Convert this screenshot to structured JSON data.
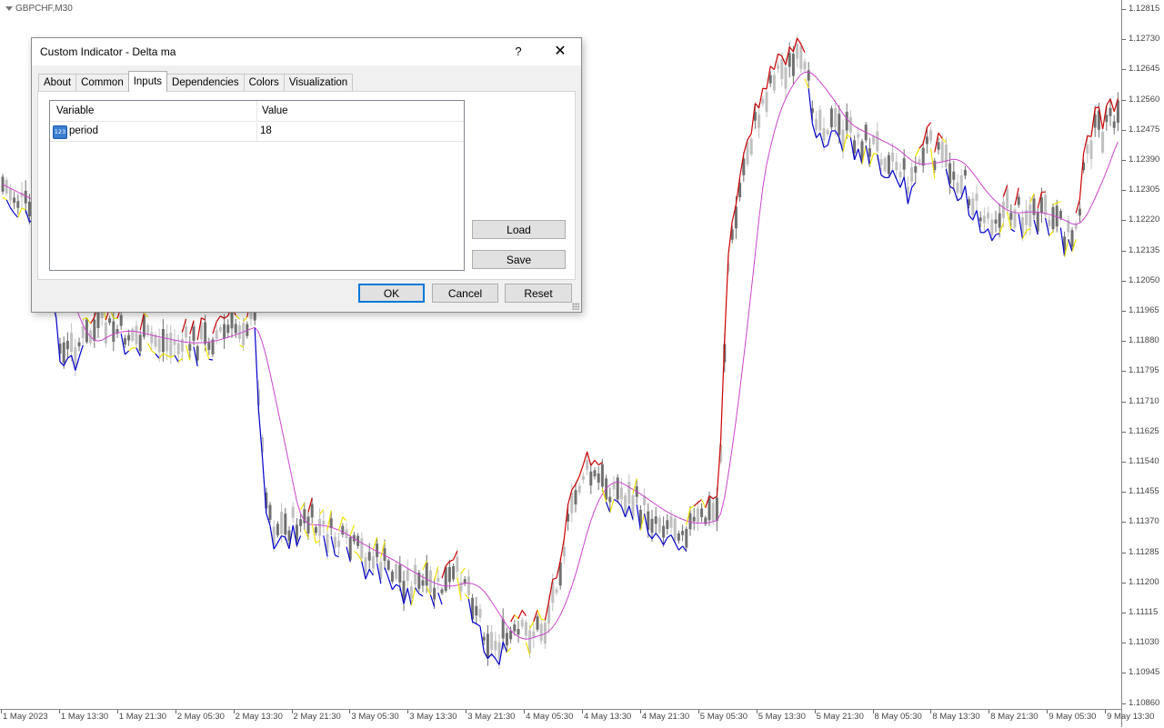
{
  "chart": {
    "symbol": "GBPCHF,M30",
    "price_ticks": [
      "1.12815",
      "1.12730",
      "1.12645",
      "1.12560",
      "1.12475",
      "1.12390",
      "1.12305",
      "1.12220",
      "1.12135",
      "1.12050",
      "1.11965",
      "1.11880",
      "1.11795",
      "1.11710",
      "1.11625",
      "1.11540",
      "1.11455",
      "1.11370",
      "1.11285",
      "1.11200",
      "1.11115",
      "1.11030",
      "1.10945",
      "1.10860"
    ],
    "time_ticks": [
      "1 May 2023",
      "1 May 13:30",
      "1 May 21:30",
      "2 May 05:30",
      "2 May 13:30",
      "2 May 21:30",
      "3 May 05:30",
      "3 May 13:30",
      "3 May 21:30",
      "4 May 05:30",
      "4 May 13:30",
      "4 May 21:30",
      "5 May 05:30",
      "5 May 13:30",
      "5 May 21:30",
      "8 May 05:30",
      "8 May 13:30",
      "8 May 21:30",
      "9 May 05:30",
      "9 May 13:30"
    ],
    "colors": {
      "candle_bull": "#c0c0c0",
      "candle_bear": "#707070",
      "line_up": "#cc0000",
      "line_down": "#0000cc",
      "line_neutral": "#f0e000",
      "ma": "#cc44cc"
    }
  },
  "dialog": {
    "title": "Custom Indicator - Delta ma",
    "help_label": "?",
    "close_label": "✕",
    "tabs": [
      "About",
      "Common",
      "Inputs",
      "Dependencies",
      "Colors",
      "Visualization"
    ],
    "active_tab": "Inputs",
    "table": {
      "headers": [
        "Variable",
        "Value"
      ],
      "rows": [
        {
          "icon": "number-icon",
          "icon_text": "123",
          "variable": "period",
          "value": "18"
        }
      ]
    },
    "load_label": "Load",
    "save_label": "Save",
    "ok_label": "OK",
    "cancel_label": "Cancel",
    "reset_label": "Reset"
  }
}
